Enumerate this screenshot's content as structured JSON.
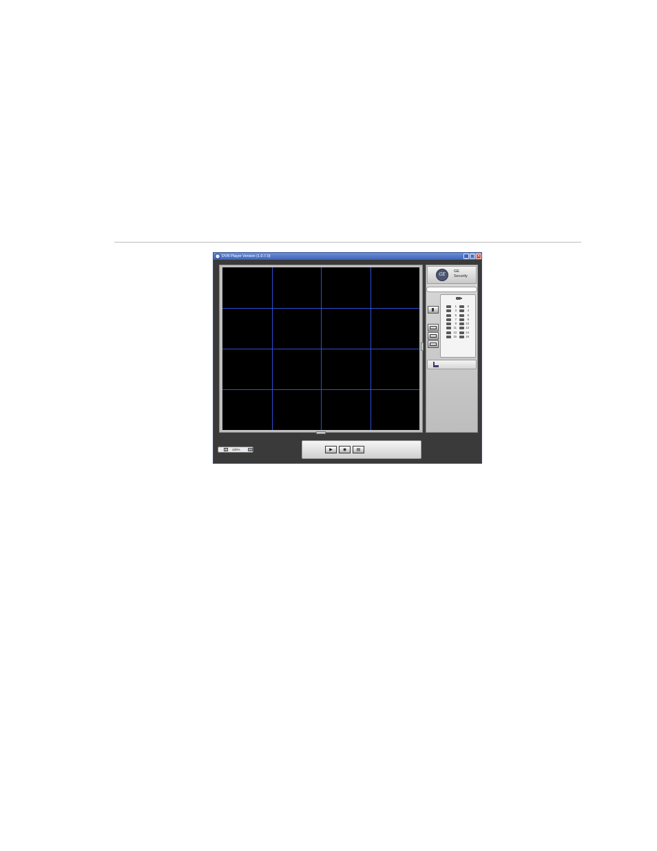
{
  "window": {
    "title": "DVR Player Version (1.0.7.0)",
    "controls": {
      "minimize": "_",
      "maximize": "□",
      "close": "×"
    }
  },
  "video_grid": {
    "rows": 4,
    "cols": 4,
    "background": "#000000",
    "line_color": "#2f4fd8"
  },
  "sidebar": {
    "logo": {
      "emblem": "GE",
      "line1": "GE",
      "line2": "Security"
    },
    "camera_list": [
      {
        "left": "1",
        "right": "2"
      },
      {
        "left": "3",
        "right": "4"
      },
      {
        "left": "5",
        "right": "6"
      },
      {
        "left": "7",
        "right": "8"
      },
      {
        "left": "9",
        "right": "10"
      },
      {
        "left": "11",
        "right": "12"
      },
      {
        "left": "13",
        "right": "14"
      },
      {
        "left": "15",
        "right": "16"
      }
    ]
  },
  "zoom": {
    "value": "100%",
    "dropdown_icon": "chevron-down-icon"
  },
  "playback": {
    "play_icon": "▶",
    "capture_icon": "◉",
    "layout_icon": "▤"
  }
}
